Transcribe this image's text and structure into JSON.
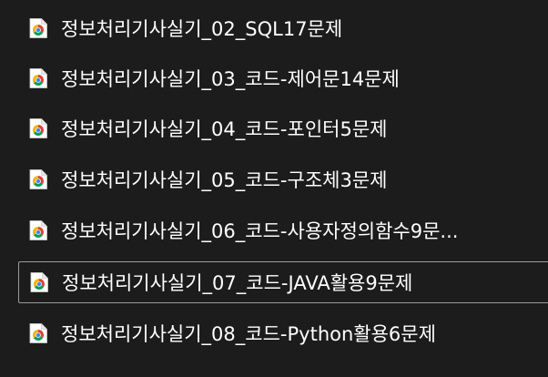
{
  "files": [
    {
      "name": "정보처리기사실기_02_SQL17문제",
      "icon": "chrome-html-document-icon",
      "selected": false
    },
    {
      "name": "정보처리기사실기_03_코드-제어문14문제",
      "icon": "chrome-html-document-icon",
      "selected": false
    },
    {
      "name": "정보처리기사실기_04_코드-포인터5문제",
      "icon": "chrome-html-document-icon",
      "selected": false
    },
    {
      "name": "정보처리기사실기_05_코드-구조체3문제",
      "icon": "chrome-html-document-icon",
      "selected": false
    },
    {
      "name": "정보처리기사실기_06_코드-사용자정의함수9문...",
      "icon": "chrome-html-document-icon",
      "selected": false
    },
    {
      "name": "정보처리기사실기_07_코드-JAVA활용9문제",
      "icon": "chrome-html-document-icon",
      "selected": true
    },
    {
      "name": "정보처리기사실기_08_코드-Python활용6문제",
      "icon": "chrome-html-document-icon",
      "selected": false
    }
  ],
  "colors": {
    "background": "#1c1c1c",
    "text": "#ffffff",
    "selection_border": "#9a9a9a",
    "chrome_red": "#db4437",
    "chrome_green": "#0f9d58",
    "chrome_yellow": "#f4b400",
    "chrome_blue": "#4285f4"
  }
}
